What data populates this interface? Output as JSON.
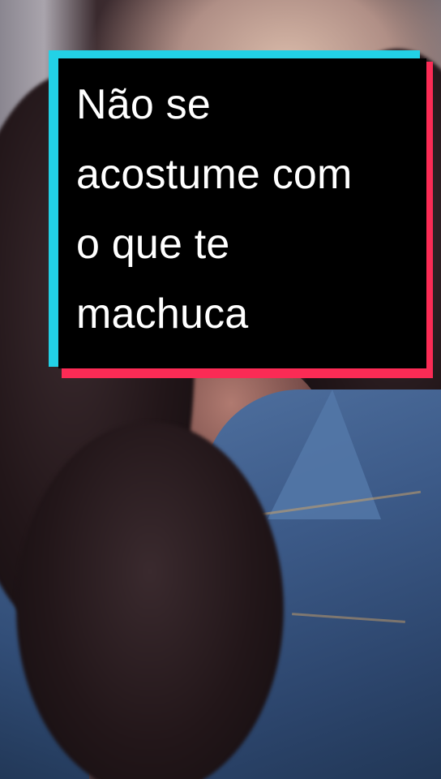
{
  "caption": {
    "text": "Não se\nacostume com\no que te\nmachuca"
  },
  "colors": {
    "caption_background": "#000000",
    "caption_text": "#ffffff",
    "border_cyan": "#22d1e6",
    "border_red": "#fb2b55"
  }
}
